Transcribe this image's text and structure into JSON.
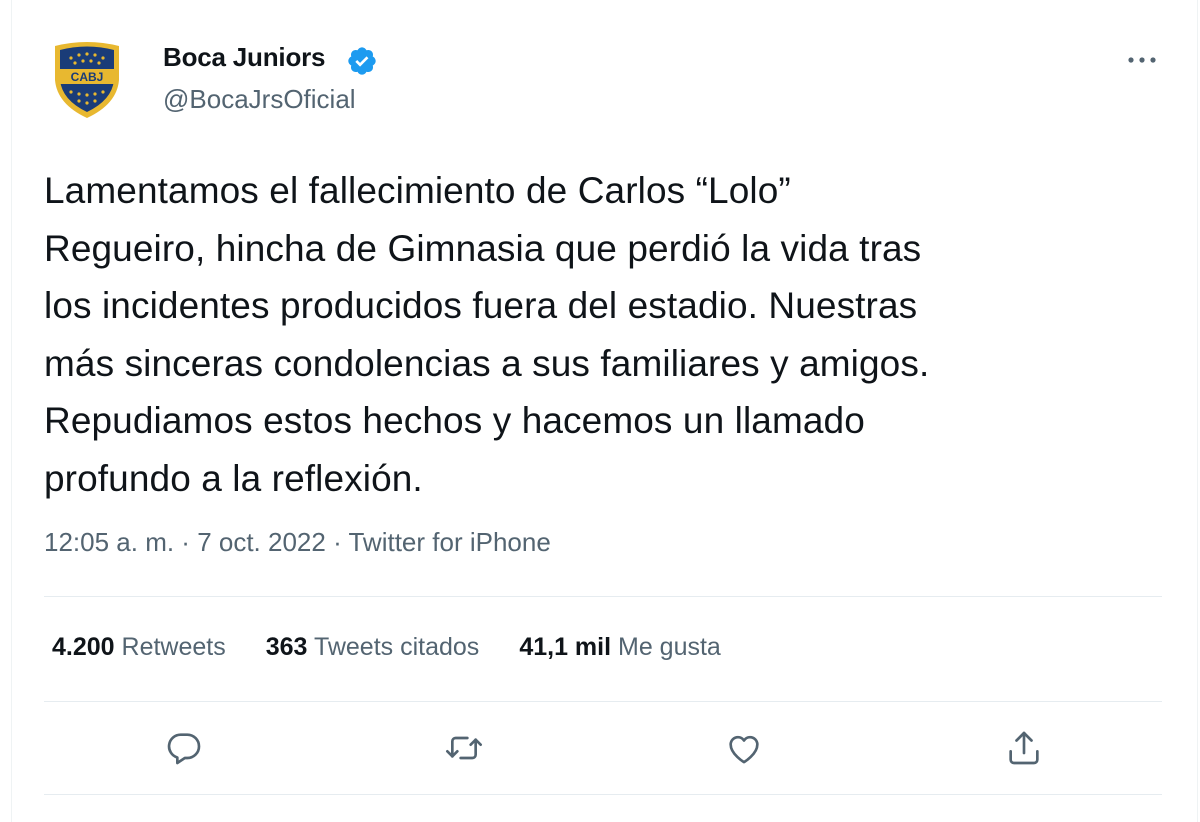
{
  "author": {
    "display_name": "Boca Juniors",
    "handle": "@BocaJrsOficial",
    "verified": true,
    "logo_text": "CABJ"
  },
  "tweet": {
    "text": "Lamentamos el fallecimiento de Carlos “Lolo”\nRegueiro, hincha de Gimnasia que perdió la vida tras\nlos incidentes producidos fuera del estadio. Nuestras\nmás sinceras condolencias a sus familiares y amigos.\nRepudiamos estos hechos y hacemos un llamado\nprofundo a la reflexión."
  },
  "meta": {
    "time": "12:05 a. m.",
    "separator": " · ",
    "date": "7 oct. 2022",
    "source": "Twitter for iPhone"
  },
  "stats": {
    "retweets_count": "4.200",
    "retweets_label": "Retweets",
    "quotes_count": "363",
    "quotes_label": "Tweets citados",
    "likes_count": "41,1 mil",
    "likes_label": "Me gusta"
  },
  "actions": [
    "reply-icon",
    "retweet-icon",
    "like-icon",
    "share-icon"
  ],
  "colors": {
    "text": "#0f1419",
    "secondary": "#536471",
    "verified": "#1d9bf0",
    "divider": "#e6ecf0",
    "shield_blue": "#1a3c78",
    "shield_gold": "#e8b830"
  }
}
